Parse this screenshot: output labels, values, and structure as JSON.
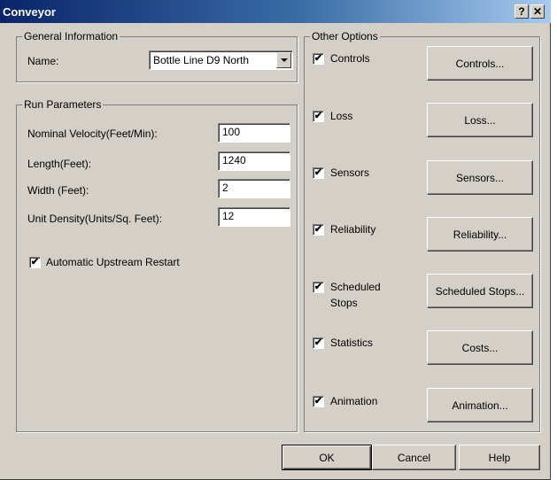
{
  "window": {
    "title": "Conveyor",
    "help_btn": "?",
    "close_btn": "✕"
  },
  "general": {
    "group_label": "General Information",
    "name_label": "Name:",
    "name_value": "Bottle Line D9 North"
  },
  "run": {
    "group_label": "Run Parameters",
    "fields": [
      {
        "label": "Nominal Velocity(Feet/Min):",
        "value": "100"
      },
      {
        "label": "Length(Feet):",
        "value": "1240"
      },
      {
        "label": "Width (Feet):",
        "value": "2"
      },
      {
        "label": "Unit Density(Units/Sq. Feet):",
        "value": "12"
      }
    ],
    "auto_restart_label": "Automatic Upstream Restart",
    "auto_restart_checked": true
  },
  "other": {
    "group_label": "Other Options",
    "options": [
      {
        "label": "Controls",
        "checked": true,
        "button": "Controls..."
      },
      {
        "label": "Loss",
        "checked": true,
        "button": "Loss..."
      },
      {
        "label": "Sensors",
        "checked": true,
        "button": "Sensors..."
      },
      {
        "label": "Reliability",
        "checked": true,
        "button": "Reliability..."
      },
      {
        "label": "Scheduled",
        "label2": "Stops",
        "checked": true,
        "button": "Scheduled Stops..."
      },
      {
        "label": "Statistics",
        "checked": true,
        "button": "Costs..."
      },
      {
        "label": "Animation",
        "checked": true,
        "button": "Animation..."
      }
    ]
  },
  "footer": {
    "ok": "OK",
    "cancel": "Cancel",
    "help": "Help"
  },
  "check_glyph": "✔"
}
